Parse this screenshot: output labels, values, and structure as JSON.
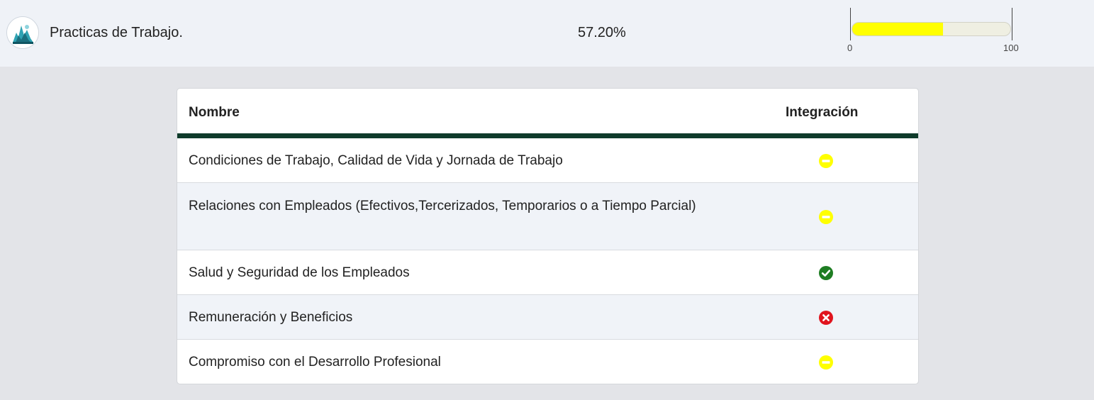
{
  "header": {
    "avatar_icon": "forest-landscape-avatar-icon",
    "title": "Practicas de Trabajo.",
    "percent_text": "57.20%",
    "progress": {
      "value": 57.2,
      "min_label": "0",
      "max_label": "100",
      "fill_color": "#ffff00"
    }
  },
  "table": {
    "columns": [
      "Nombre",
      "Integración"
    ],
    "header_border_color": "#0f3b2b",
    "rows": [
      {
        "name": "Condiciones de Trabajo, Calidad de Vida y Jornada de Trabajo",
        "status": "partial",
        "icon": "minus-circle-icon"
      },
      {
        "name": "Relaciones con Empleados (Efectivos,Tercerizados, Temporarios o a Tiempo Parcial)",
        "status": "partial",
        "icon": "minus-circle-icon"
      },
      {
        "name": "Salud y Seguridad de los Empleados",
        "status": "complete",
        "icon": "check-circle-icon"
      },
      {
        "name": "Remuneración y Beneficios",
        "status": "missing",
        "icon": "x-circle-icon"
      },
      {
        "name": "Compromiso con el Desarrollo Profesional",
        "status": "partial",
        "icon": "minus-circle-icon"
      }
    ],
    "status_colors": {
      "partial": "#ffff00",
      "complete": "#1e7d22",
      "missing": "#e0141e"
    }
  }
}
